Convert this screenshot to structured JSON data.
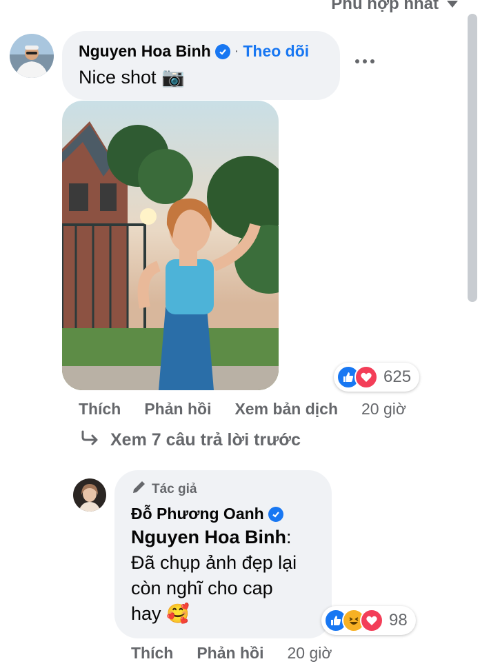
{
  "sort": {
    "label": "Phù hợp nhất"
  },
  "comment1": {
    "author": "Nguyen Hoa Binh",
    "follow": "Theo dõi",
    "separator": "·",
    "text": "Nice shot 📷",
    "reaction_count": "625",
    "actions": {
      "like": "Thích",
      "reply": "Phản hồi",
      "translate": "Xem bản dịch",
      "time": "20 giờ"
    }
  },
  "view_replies": "Xem 7 câu trả lời trước",
  "reply1": {
    "badge": "Tác giả",
    "author": "Đỗ Phương Oanh",
    "mention": "Nguyen Hoa Binh",
    "mention_suffix": ":",
    "text_line1": "Đã chụp ảnh đẹp lại",
    "text_line2": "còn nghĩ cho cap",
    "text_line3": "hay 🥰",
    "reaction_count": "98",
    "actions": {
      "like": "Thích",
      "reply": "Phản hồi",
      "time": "20 giờ"
    }
  },
  "colors": {
    "accent": "#1877f2",
    "bubble": "#f0f2f5",
    "secondary_text": "#65676b",
    "love": "#f33e58",
    "haha": "#f7b125"
  },
  "icons": [
    "caret-down-icon",
    "verified-icon",
    "more-icon",
    "like-reaction-icon",
    "love-reaction-icon",
    "haha-reaction-icon",
    "reply-arrow-icon",
    "pencil-icon"
  ]
}
